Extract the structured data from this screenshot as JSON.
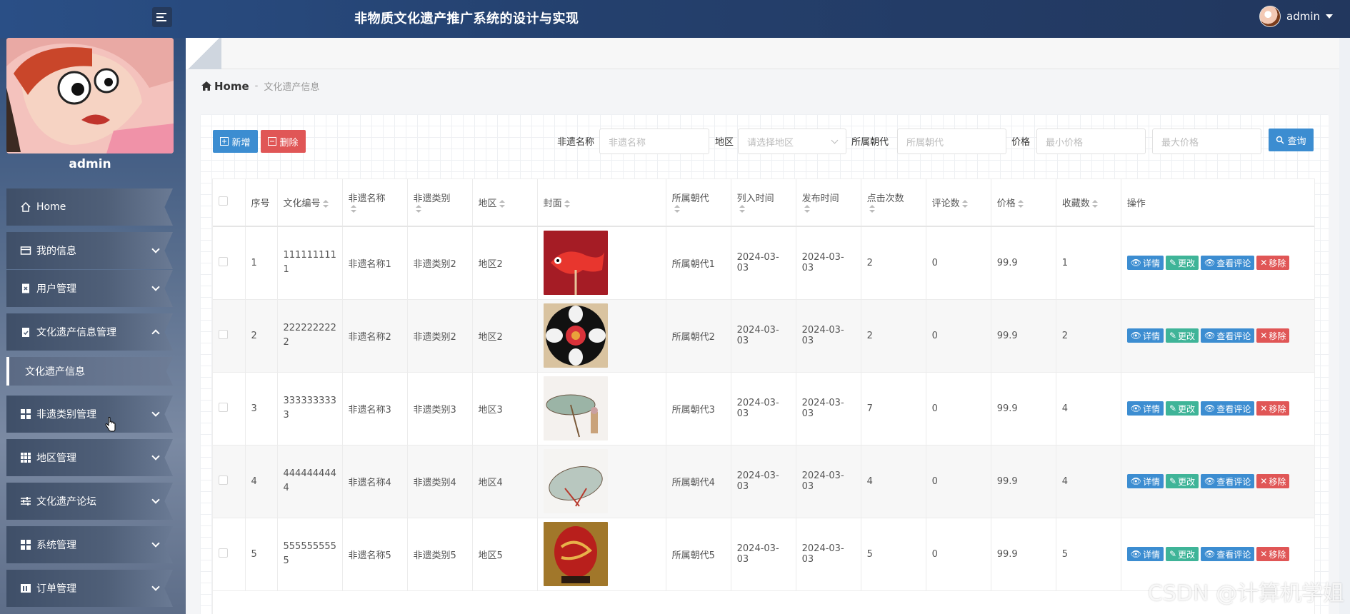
{
  "header": {
    "title": "非物质文化遗产推广系统的设计与实现",
    "user": "admin"
  },
  "sidebar": {
    "profile_name": "admin",
    "items": [
      {
        "label": "Home",
        "icon": "home-icon"
      },
      {
        "label": "我的信息",
        "icon": "card-icon"
      },
      {
        "label": "用户管理",
        "icon": "user-doc-icon"
      },
      {
        "label": "文化遗产信息管理",
        "icon": "clipboard-icon"
      },
      {
        "label": "非遗类别管理",
        "icon": "grid-icon"
      },
      {
        "label": "地区管理",
        "icon": "grid-icon"
      },
      {
        "label": "文化遗产论坛",
        "icon": "sliders-icon"
      },
      {
        "label": "系统管理",
        "icon": "grid-icon"
      },
      {
        "label": "订单管理",
        "icon": "bars-icon"
      }
    ],
    "sub_item": "文化遗产信息"
  },
  "breadcrumb": {
    "home": "Home",
    "sep": "-",
    "current": "文化遗产信息"
  },
  "toolbar": {
    "add": "新增",
    "delete": "删除",
    "query": "查询",
    "name_label": "非遗名称",
    "name_placeholder": "非遗名称",
    "region_label": "地区",
    "region_placeholder": "请选择地区",
    "dynasty_label": "所属朝代",
    "dynasty_placeholder": "所属朝代",
    "price_label": "价格",
    "min_price_placeholder": "最小价格",
    "max_price_placeholder": "最大价格"
  },
  "table": {
    "headers": {
      "index": "序号",
      "code": "文化编号",
      "name": "非遗名称",
      "category": "非遗类别",
      "region": "地区",
      "cover": "封面",
      "dynasty": "所属朝代",
      "listed": "列入时间",
      "published": "发布时间",
      "clicks": "点击次数",
      "comments": "评论数",
      "price": "价格",
      "favorites": "收藏数",
      "ops": "操作"
    },
    "ops": {
      "detail": "详情",
      "edit": "更改",
      "view_comments": "查看评论",
      "remove": "移除"
    },
    "rows": [
      {
        "index": "1",
        "code": "1111111111",
        "name": "非遗名称1",
        "category": "非遗类别2",
        "region": "地区2",
        "dynasty": "所属朝代1",
        "listed": "2024-03-03",
        "published": "2024-03-03",
        "clicks": "2",
        "comments": "0",
        "price": "99.9",
        "favorites": "1"
      },
      {
        "index": "2",
        "code": "2222222222",
        "name": "非遗名称2",
        "category": "非遗类别2",
        "region": "地区2",
        "dynasty": "所属朝代2",
        "listed": "2024-03-03",
        "published": "2024-03-03",
        "clicks": "2",
        "comments": "0",
        "price": "99.9",
        "favorites": "2"
      },
      {
        "index": "3",
        "code": "3333333333",
        "name": "非遗名称3",
        "category": "非遗类别3",
        "region": "地区3",
        "dynasty": "所属朝代3",
        "listed": "2024-03-03",
        "published": "2024-03-03",
        "clicks": "7",
        "comments": "0",
        "price": "99.9",
        "favorites": "4"
      },
      {
        "index": "4",
        "code": "4444444444",
        "name": "非遗名称4",
        "category": "非遗类别4",
        "region": "地区4",
        "dynasty": "所属朝代4",
        "listed": "2024-03-03",
        "published": "2024-03-03",
        "clicks": "4",
        "comments": "0",
        "price": "99.9",
        "favorites": "4"
      },
      {
        "index": "5",
        "code": "5555555555",
        "name": "非遗名称5",
        "category": "非遗类别5",
        "region": "地区5",
        "dynasty": "所属朝代5",
        "listed": "2024-03-03",
        "published": "2024-03-03",
        "clicks": "5",
        "comments": "0",
        "price": "99.9",
        "favorites": "5"
      }
    ]
  },
  "watermark": "CSDN @计算机学姐"
}
